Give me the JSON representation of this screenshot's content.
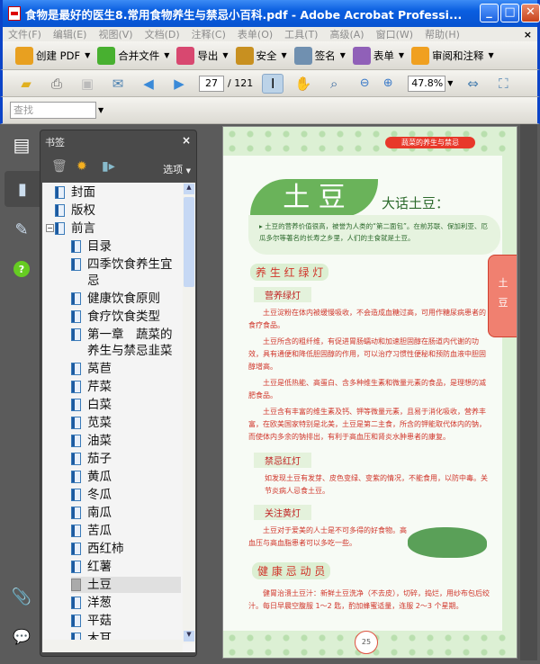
{
  "window": {
    "title": "食物是最好的医生8.常用食物养生与禁忌小百科.pdf - Adobe Acrobat Professi...",
    "min": "_",
    "max": "□",
    "close": "✕"
  },
  "menu": [
    "文件(F)",
    "编辑(E)",
    "视图(V)",
    "文档(D)",
    "注释(C)",
    "表单(O)",
    "工具(T)",
    "高级(A)",
    "窗口(W)",
    "帮助(H)"
  ],
  "menu_close": "×",
  "toolbar1": [
    {
      "label": "创建 PDF",
      "icon": "create-pdf-icon",
      "color": "#e8a020"
    },
    {
      "label": "合并文件",
      "icon": "combine-files-icon",
      "color": "#48b030"
    },
    {
      "label": "导出",
      "icon": "export-icon",
      "color": "#d84870"
    },
    {
      "label": "安全",
      "icon": "lock-icon",
      "color": "#c89020"
    },
    {
      "label": "签名",
      "icon": "pen-icon",
      "color": "#7090b0"
    },
    {
      "label": "表单",
      "icon": "form-icon",
      "color": "#9060b8"
    },
    {
      "label": "审阅和注释",
      "icon": "comment-icon",
      "color": "#f0a020"
    }
  ],
  "toolbar2": {
    "page_current": "27",
    "page_total": "/ 121",
    "zoom": "47.8%"
  },
  "find": {
    "placeholder": "查找"
  },
  "bookmarks": {
    "title": "书签",
    "close": "×",
    "options": "选项",
    "items": [
      {
        "label": "封面",
        "level": 0
      },
      {
        "label": "版权",
        "level": 0
      },
      {
        "label": "前言",
        "level": 0,
        "expanded": true
      },
      {
        "label": "目录",
        "level": 1
      },
      {
        "label": "四季饮食养生宜\n忌",
        "level": 1
      },
      {
        "label": "健康饮食原则",
        "level": 1
      },
      {
        "label": "食疗饮食类型",
        "level": 1
      },
      {
        "label": "第一章　蔬菜的\n养生与禁忌韭菜",
        "level": 1
      },
      {
        "label": "莴苣",
        "level": 1
      },
      {
        "label": "芹菜",
        "level": 1
      },
      {
        "label": "白菜",
        "level": 1
      },
      {
        "label": "苋菜",
        "level": 1
      },
      {
        "label": "油菜",
        "level": 1
      },
      {
        "label": "茄子",
        "level": 1
      },
      {
        "label": "黄瓜",
        "level": 1
      },
      {
        "label": "冬瓜",
        "level": 1
      },
      {
        "label": "南瓜",
        "level": 1
      },
      {
        "label": "苦瓜",
        "level": 1
      },
      {
        "label": "西红柿",
        "level": 1
      },
      {
        "label": "红薯",
        "level": 1
      },
      {
        "label": "土豆",
        "level": 1,
        "selected": true
      },
      {
        "label": "洋葱",
        "level": 1
      },
      {
        "label": "平菇",
        "level": 1
      },
      {
        "label": "木耳",
        "level": 1
      }
    ]
  },
  "page": {
    "header": "蔬菜的养生与禁忌",
    "title": "土 豆",
    "subtitle": "大话土豆：",
    "intro": "▸ 土豆的营养价值很高，被誉为人类的“第二面包”。在前苏联、保加利亚、厄瓜多尔等著名的长寿之乡里，人们的主食就是土豆。",
    "section1": "养 生 红 绿 灯",
    "green": "营养绿灯",
    "p1": "土豆淀粉在体内被缓慢吸收，不会造成血糖过高，可用作糖尿病患者的食疗食品。",
    "p2": "土豆所含的粗纤维，有促进胃肠蠕动和加速胆固醇在肠道内代谢的功效，具有通便和降低胆固醇的作用，可以治疗习惯性便秘和预防血液中胆固醇增高。",
    "p3": "土豆是低热能、高蛋白、含多种维生素和微量元素的食品，是理想的减肥食品。",
    "p4": "土豆含有丰富的维生素及钙、钾等微量元素，且易于消化吸收，营养丰富，在欧美国家特别是北美，土豆是第二主食，所含的钾能取代体内的钠，而使体内多余的钠排出，有利于高血压和肾炎水肿患者的康复。",
    "red": "禁忌红灯",
    "p5": "如发现土豆有发芽、皮色变绿、变紫的情况，不能食用，以防中毒。关节炎病人忌食土豆。",
    "yellow": "关注黄灯",
    "p6": "土豆对于爱美的人士是不可多得的好食物。高血压与高血脂患者可以多吃一些。",
    "section2": "健 康 忌 动 员",
    "p7": "健胃治溃土豆汁：新鲜土豆洗净（不去皮），切碎，捣烂，用纱布包后绞汁。每日早晨空腹服 1～2 匙，酌加蜂蜜适量，连服 2～3 个星期。",
    "tab": "土\n豆",
    "page_number": "25"
  }
}
